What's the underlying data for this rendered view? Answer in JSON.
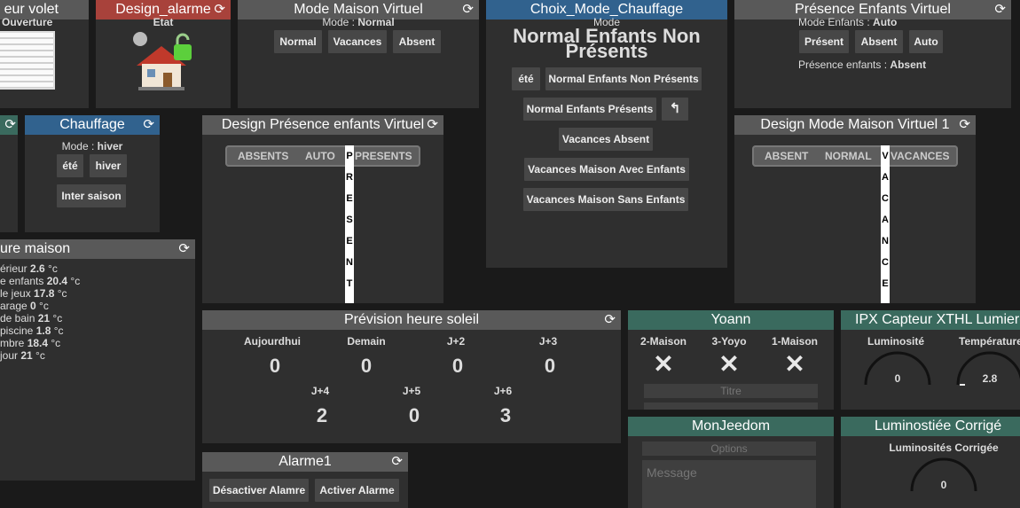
{
  "volet": {
    "title": "eur volet",
    "label": "Ouverture"
  },
  "alarme": {
    "title": "Design_alarme",
    "label": "Etat"
  },
  "modeMaison": {
    "title": "Mode Maison Virtuel",
    "mode_label": "Mode : ",
    "mode_value": "Normal",
    "buttons": [
      "Normal",
      "Vacances",
      "Absent"
    ]
  },
  "choixChauffage": {
    "title": "Choix_Mode_Chauffage",
    "mode_label": "Mode",
    "mode_value": "Normal Enfants Non Présents",
    "buttons": [
      "été",
      "Normal Enfants Non Présents",
      "Normal Enfants Présents",
      "↰",
      "Vacances Absent",
      "Vacances Maison Avec Enfants",
      "Vacances Maison Sans Enfants"
    ]
  },
  "presenceEnfants": {
    "title": "Présence Enfants Virtuel",
    "mode_label": "Mode Enfants : ",
    "mode_value": "Auto",
    "buttons": [
      "Présent",
      "Absent",
      "Auto"
    ],
    "presence_label": "Présence enfants : ",
    "presence_value": "Absent"
  },
  "chauffage": {
    "title": "Chauffage",
    "mode_label": "Mode : ",
    "mode_value": "hiver",
    "buttons": [
      "été",
      "hiver",
      "Inter saison"
    ]
  },
  "designPresence": {
    "title": "Design Présence enfants Virtuel",
    "options": [
      "ABSENTS",
      "AUTO",
      "PRESENTS"
    ],
    "vertical": "PRESENT"
  },
  "designModeMaison": {
    "title": "Design Mode Maison Virtuel 1",
    "options": [
      "ABSENT",
      "NORMAL",
      "VACANCES"
    ],
    "vertical": "VACANCE"
  },
  "temperature": {
    "title": "ure maison",
    "rows": [
      {
        "name": "érieur",
        "value": "2.6",
        "unit": "°c"
      },
      {
        "name": "e enfants",
        "value": "20.4",
        "unit": "°c"
      },
      {
        "name": "le jeux",
        "value": "17.8",
        "unit": "°c"
      },
      {
        "name": "arage",
        "value": "0",
        "unit": "°c"
      },
      {
        "name": "de bain",
        "value": "21",
        "unit": "°c"
      },
      {
        "name": "piscine",
        "value": "1.8",
        "unit": "°c"
      },
      {
        "name": "mbre",
        "value": "18.4",
        "unit": "°c"
      },
      {
        "name": "jour",
        "value": "21",
        "unit": "°c"
      }
    ]
  },
  "prevision": {
    "title": "Prévision heure soleil",
    "days": [
      {
        "label": "Aujourdhui",
        "value": "0"
      },
      {
        "label": "Demain",
        "value": "0"
      },
      {
        "label": "J+2",
        "value": "0"
      },
      {
        "label": "J+3",
        "value": "0"
      },
      {
        "label": "J+4",
        "value": "2"
      },
      {
        "label": "J+5",
        "value": "0"
      },
      {
        "label": "J+6",
        "value": "3"
      }
    ]
  },
  "yoann": {
    "title": "Yoann",
    "cols": [
      "2-Maison",
      "3-Yoyo",
      "1-Maison"
    ],
    "mark": "✕",
    "titre_placeholder": "Titre"
  },
  "ipx": {
    "title": "IPX Capteur XTHL Lumiere",
    "lum_label": "Luminosité",
    "lum_value": "0",
    "temp_label": "Température",
    "temp_value": "2.8"
  },
  "alarme1": {
    "title": "Alarme1",
    "buttons": [
      "Désactiver Alamre",
      "Activer Alarme"
    ]
  },
  "monjeedom": {
    "title": "MonJeedom",
    "options_placeholder": "Options",
    "message_placeholder": "Message"
  },
  "lumCorrige": {
    "title": "Luminostiée Corrigé",
    "label": "Luminosités Corrigée",
    "value": "0"
  }
}
